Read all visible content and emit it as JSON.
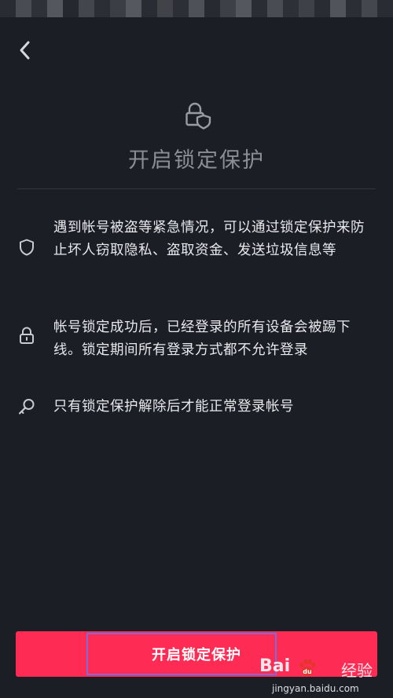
{
  "header": {
    "back_icon": "chevron-left-icon",
    "lock_icon": "lock-shield-icon",
    "title": "开启锁定保护"
  },
  "info_items": [
    {
      "icon": "shield-icon",
      "text": "遇到帐号被盗等紧急情况，可以通过锁定保护来防止坏人窃取隐私、盗取资金、发送垃圾信息等"
    },
    {
      "icon": "lock-icon",
      "text": "帐号锁定成功后，已经登录的所有设备会被踢下线。锁定期间所有登录方式都不允许登录"
    },
    {
      "icon": "key-icon",
      "text": "只有锁定保护解除后才能正常登录帐号"
    }
  ],
  "footer": {
    "enable_button_label": "开启锁定保护"
  },
  "watermark": {
    "brand": "Bai",
    "brand_cn": "经验",
    "url": "jingyan.baidu.com"
  },
  "colors": {
    "background": "#1c1e26",
    "accent": "#fe2c55",
    "title_gray": "#8d8e95",
    "text": "#e9e9ec"
  }
}
